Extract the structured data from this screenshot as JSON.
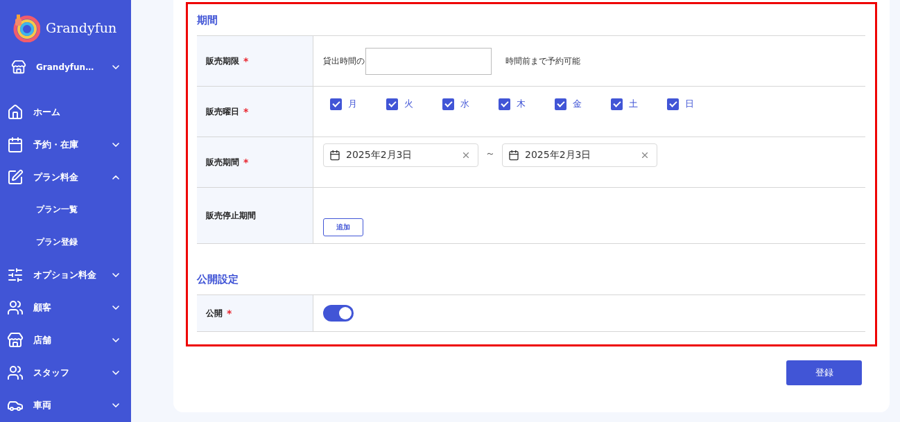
{
  "sidebar": {
    "logo_text": "Grandyfun",
    "store": {
      "label": "Grandyfun…",
      "expanded": false
    },
    "items": [
      {
        "label": "ホーム"
      },
      {
        "label": "予約・在庫",
        "expanded": false
      },
      {
        "label": "プラン料金",
        "expanded": true,
        "children": [
          {
            "label": "プラン一覧"
          },
          {
            "label": "プラン登録"
          }
        ]
      },
      {
        "label": "オプション料金",
        "expanded": false
      },
      {
        "label": "顧客",
        "expanded": false
      },
      {
        "label": "店舗",
        "expanded": false
      },
      {
        "label": "スタッフ",
        "expanded": false
      },
      {
        "label": "車両",
        "expanded": false
      }
    ]
  },
  "form": {
    "sections": [
      {
        "title": "期間",
        "rows": [
          {
            "label": "販売期限",
            "required_mark": "*",
            "kind": "deadline",
            "prefix": "貸出時間の",
            "suffix": "時間前まで予約可能"
          },
          {
            "label": "販売曜日",
            "required_mark": "*",
            "kind": "weekdays",
            "days": [
              {
                "label": "月",
                "checked": true
              },
              {
                "label": "火",
                "checked": true
              },
              {
                "label": "水",
                "checked": true
              },
              {
                "label": "木",
                "checked": true
              },
              {
                "label": "金",
                "checked": true
              },
              {
                "label": "土",
                "checked": true
              },
              {
                "label": "日",
                "checked": true
              }
            ]
          },
          {
            "label": "販売期間",
            "required_mark": "*",
            "kind": "date_range",
            "start": "2025年2月3日",
            "separator": "～",
            "end": "2025年2月3日"
          },
          {
            "label": "販売停止期間",
            "kind": "add",
            "button": "追加"
          }
        ]
      },
      {
        "title": "公開設定",
        "rows": [
          {
            "label": "公開",
            "required_mark": "*",
            "kind": "toggle",
            "on": true
          }
        ]
      }
    ]
  },
  "submit_button": "登録"
}
